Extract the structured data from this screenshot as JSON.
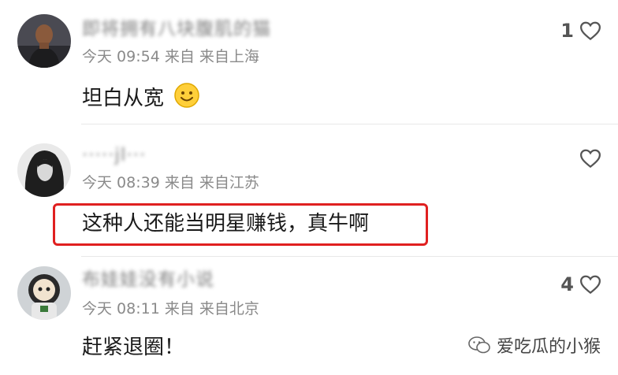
{
  "comments": [
    {
      "username": "即将拥有八块腹肌的猫",
      "time": "今天 09:54",
      "source": "来自",
      "location": "来自上海",
      "text": "坦白从宽",
      "likes": "1",
      "avatar_icon": "man-portrait-avatar"
    },
    {
      "username": "·····jl···",
      "time": "今天 08:39",
      "source": "来自",
      "location": "来自江苏",
      "text": "这种人还能当明星赚钱，真牛啊",
      "likes": "",
      "avatar_icon": "dark-hair-portrait-avatar"
    },
    {
      "username": "布娃娃没有小说",
      "time": "今天 08:11",
      "source": "来自",
      "location": "来自北京",
      "text": "赶紧退圈！",
      "likes": "4",
      "avatar_icon": "toy-astronaut-avatar"
    }
  ],
  "watermark": {
    "text": "爱吃瓜的小猴",
    "icon": "wechat-icon"
  },
  "colors": {
    "highlight": "#e02020",
    "meta": "#8a8a8a",
    "text": "#1a1a1a"
  }
}
